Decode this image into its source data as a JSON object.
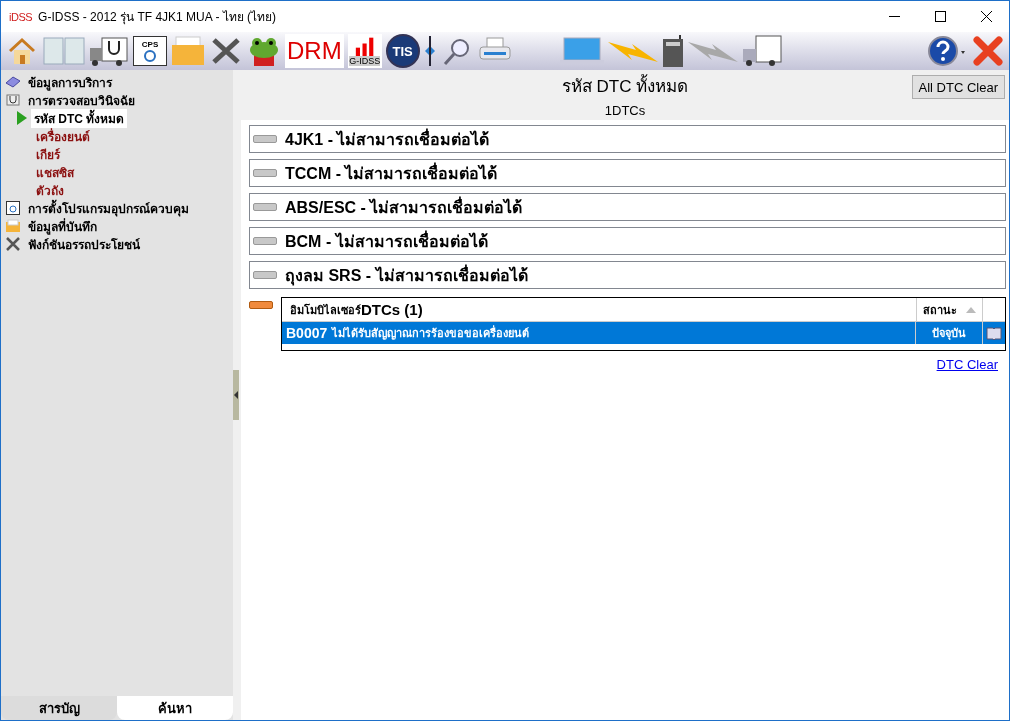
{
  "window": {
    "logo": "iDSS",
    "title": "G-IDSS - 2012 รุ่น TF 4JK1 MUA - ไทย (ไทย)"
  },
  "toolbar": {
    "cps_label": "CPS",
    "drm_label": "DRM",
    "chart_label": "G-IDSS",
    "tis_label": "TIS"
  },
  "sidebar": {
    "items": [
      {
        "label": "ข้อมูลการบริการ",
        "selected": false
      },
      {
        "label": "การตรวจสอบวินิจฉัย",
        "selected": false,
        "children": [
          {
            "label": "รหัส DTC ทั้งหมด",
            "selected": true
          },
          {
            "label": "เครื่องยนต์",
            "selected": false
          },
          {
            "label": "เกียร์",
            "selected": false
          },
          {
            "label": "แชสซิส",
            "selected": false
          },
          {
            "label": "ตัวถัง",
            "selected": false
          }
        ]
      },
      {
        "label": "การตั้งโปรแกรมอุปกรณ์ควบคุม",
        "selected": false
      },
      {
        "label": "ข้อมูลที่บันทึก",
        "selected": false
      },
      {
        "label": "ฟังก์ชันอรรถประโยชน์",
        "selected": false
      }
    ],
    "tabs": [
      {
        "label": "สารบัญ",
        "selected": true
      },
      {
        "label": "ค้นหา",
        "selected": false
      }
    ]
  },
  "main": {
    "title": "รหัส DTC ทั้งหมด",
    "count": "1DTCs",
    "clear_all_button": "All DTC Clear",
    "modules": [
      {
        "label": "4JK1 - ไม่สามารถเชื่อมต่อได้",
        "color": "#c8c8c8"
      },
      {
        "label": "TCCM - ไม่สามารถเชื่อมต่อได้",
        "color": "#c8c8c8"
      },
      {
        "label": "ABS/ESC - ไม่สามารถเชื่อมต่อได้",
        "color": "#c8c8c8"
      },
      {
        "label": "BCM - ไม่สามารถเชื่อมต่อได้",
        "color": "#c8c8c8"
      },
      {
        "label": "ถุงลม SRS - ไม่สามารถเชื่อมต่อได้",
        "color": "#c8c8c8"
      }
    ],
    "dtc_group": {
      "color": "#f08a3c",
      "system": "อิมโมบิไลเซอร์",
      "title": "DTCs (1)",
      "status_column": "สถานะ",
      "rows": [
        {
          "code": "B0007",
          "description": "ไม่ได้รับสัญญาณการร้องขอขอเครื่องยนต์",
          "status": "ปัจจุบัน",
          "selected": true
        }
      ]
    },
    "dtc_clear_link": "DTC Clear"
  }
}
